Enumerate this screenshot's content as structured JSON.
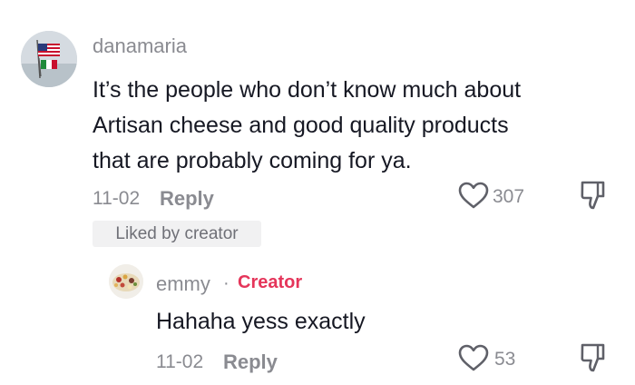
{
  "comment": {
    "username": "danamaria",
    "lines": [
      "It’s the people who don’t know much about",
      "Artisan cheese and good quality products",
      "that are probably coming for ya."
    ],
    "date": "11-02",
    "reply_label": "Reply",
    "likes": "307",
    "liked_badge": "Liked by creator"
  },
  "reply": {
    "username": "emmy",
    "separator": "·",
    "creator_label": "Creator",
    "text": "Hahaha yess exactly",
    "date": "11-02",
    "reply_label": "Reply",
    "likes": "53"
  },
  "colors": {
    "text": "#161823",
    "muted": "#8a8b91",
    "creator": "#e5355a",
    "badge_bg": "#f1f1f2"
  },
  "icons": [
    "heart-outline-icon",
    "thumbs-down-icon"
  ]
}
